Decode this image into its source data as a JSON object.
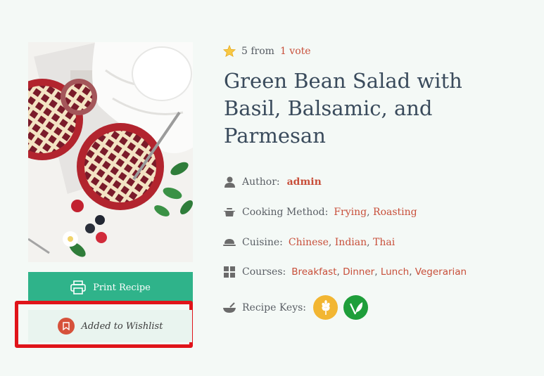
{
  "rating": {
    "score_text": "5 from",
    "vote_link": "1 vote",
    "stars": 1
  },
  "recipe": {
    "title": "Green Bean Salad with Basil, Balsamic, and Parmesan"
  },
  "meta": {
    "author_label": "Author:",
    "author": "admin",
    "cooking_method_label": "Cooking Method:",
    "cooking_methods": [
      "Frying",
      "Roasting"
    ],
    "cuisine_label": "Cuisine:",
    "cuisines": [
      "Chinese",
      "Indian",
      "Thai"
    ],
    "courses_label": "Courses:",
    "courses": [
      "Breakfast",
      "Dinner",
      "Lunch",
      "Vegerarian"
    ],
    "keys_label": "Recipe Keys:",
    "keys": [
      {
        "icon": "wheat-icon",
        "color": "#f2b632"
      },
      {
        "icon": "vegan-leaf-icon",
        "color": "#1e9e3a"
      }
    ]
  },
  "actions": {
    "print_label": "Print Recipe",
    "wishlist_label": "Added to Wishlist"
  },
  "colors": {
    "accent": "#c84f3a",
    "print_button": "#2fb38a",
    "highlight_frame": "#e0141a",
    "title": "#3a4b5c"
  }
}
